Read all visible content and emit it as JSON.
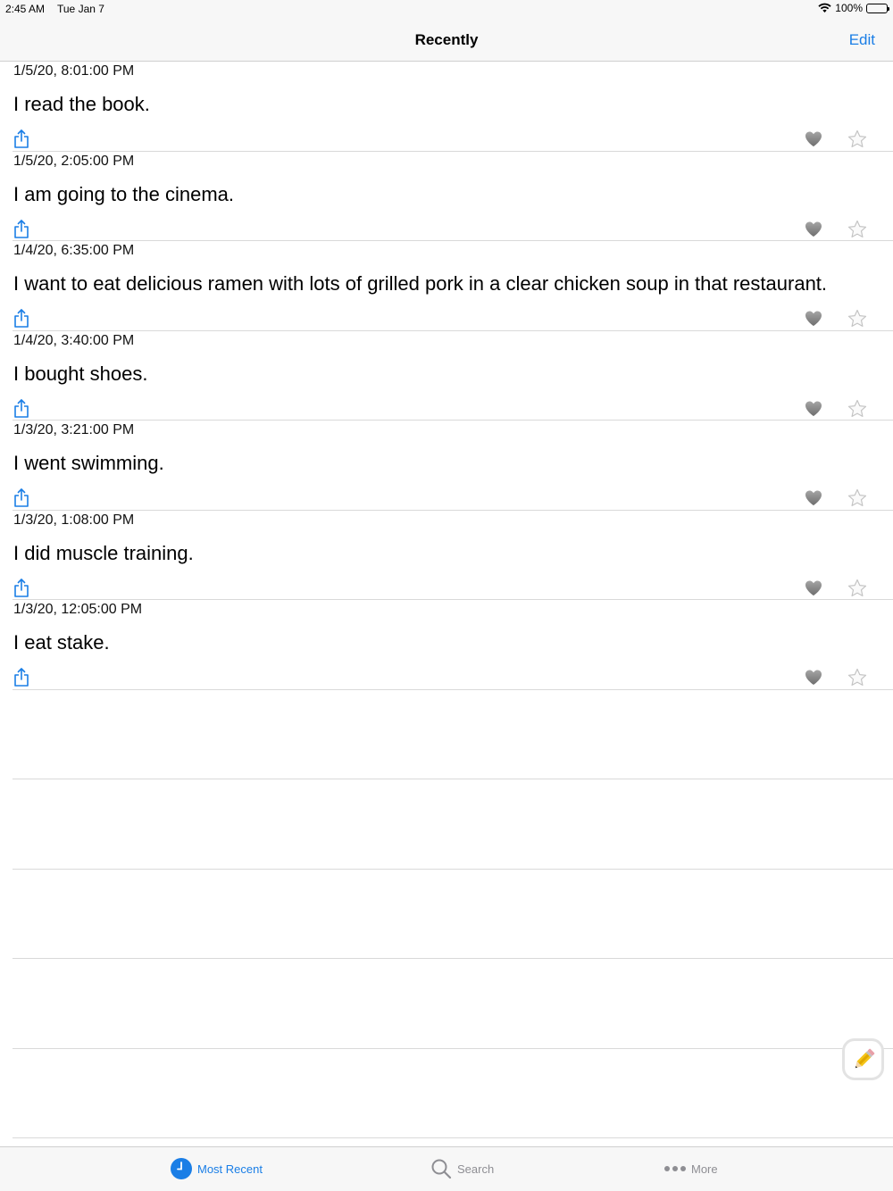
{
  "status": {
    "time": "2:45 AM",
    "date": "Tue Jan 7",
    "battery": "100%"
  },
  "nav": {
    "title": "Recently",
    "edit_label": "Edit"
  },
  "entries": [
    {
      "timestamp": "1/5/20, 8:01:00 PM",
      "text": " I read the book."
    },
    {
      "timestamp": "1/5/20, 2:05:00 PM",
      "text": "I am going to the cinema."
    },
    {
      "timestamp": "1/4/20, 6:35:00 PM",
      "text": "I want to eat delicious ramen with lots of grilled pork in a clear chicken soup in that restaurant."
    },
    {
      "timestamp": "1/4/20, 3:40:00 PM",
      "text": "I bought shoes."
    },
    {
      "timestamp": "1/3/20, 3:21:00 PM",
      "text": "I went swimming."
    },
    {
      "timestamp": "1/3/20, 1:08:00 PM",
      "text": " I did muscle training."
    },
    {
      "timestamp": "1/3/20, 12:05:00 PM",
      "text": "I eat stake."
    }
  ],
  "tabs": {
    "recent": "Most Recent",
    "search": "Search",
    "more": "More"
  },
  "colors": {
    "accent": "#1a7ee6",
    "inactive": "#8e8e93",
    "heart": "#8a8a8a"
  },
  "icons": {
    "share": "share-icon",
    "heart": "heart-icon",
    "star": "star-icon",
    "compose": "pencil-icon",
    "clock": "clock-icon",
    "search": "magnifier-icon",
    "more": "ellipsis-icon"
  }
}
